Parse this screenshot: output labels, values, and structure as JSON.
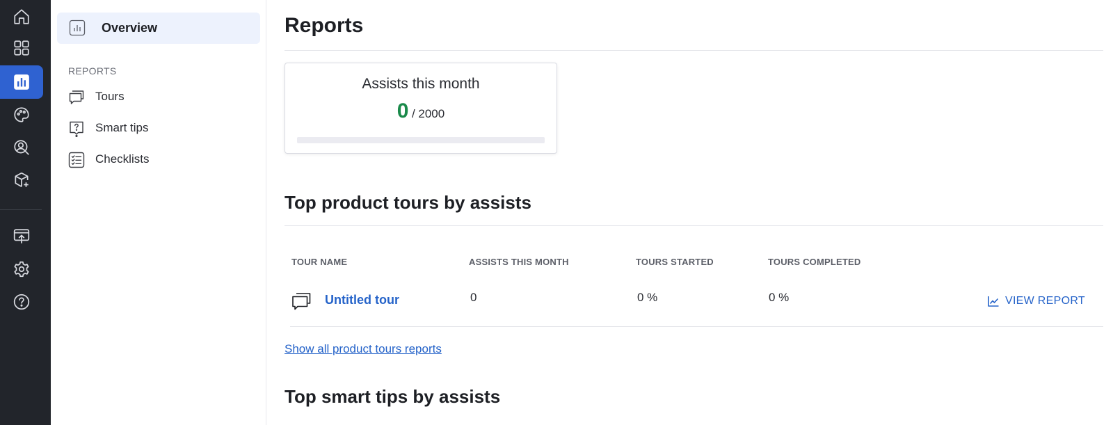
{
  "rail": {
    "items": [
      {
        "icon": "home-icon",
        "active": false
      },
      {
        "icon": "apps-grid-icon",
        "active": false
      },
      {
        "icon": "reports-chart-icon",
        "active": true
      },
      {
        "icon": "palette-icon",
        "active": false
      },
      {
        "icon": "user-search-icon",
        "active": false
      },
      {
        "icon": "package-add-icon",
        "active": false
      },
      {
        "icon": "publish-upload-icon",
        "active": false
      },
      {
        "icon": "gear-icon",
        "active": false
      },
      {
        "icon": "help-icon",
        "active": false
      }
    ],
    "active_color": "#2f62d1",
    "background": "#22252b"
  },
  "subnav": {
    "overview_label": "Overview",
    "section_label": "REPORTS",
    "items": [
      {
        "label": "Tours",
        "icon": "tours-chat-icon"
      },
      {
        "label": "Smart tips",
        "icon": "smart-tips-icon"
      },
      {
        "label": "Checklists",
        "icon": "checklist-icon"
      }
    ]
  },
  "main": {
    "title": "Reports",
    "assists_card": {
      "title": "Assists this month",
      "count": "0",
      "total": "/ 2000",
      "progress": 0
    },
    "tours_section": {
      "title": "Top product tours by assists",
      "columns": [
        "TOUR NAME",
        "ASSISTS THIS MONTH",
        "TOURS STARTED",
        "TOURS COMPLETED"
      ],
      "rows": [
        {
          "name": "Untitled tour",
          "assists": "0",
          "started": "0 %",
          "completed": "0 %",
          "action": "VIEW REPORT"
        }
      ],
      "show_all_link": "Show all product tours reports"
    },
    "smart_tips_section": {
      "title": "Top smart tips by assists"
    }
  },
  "colors": {
    "accent": "#2563c9",
    "success": "#1a8a4a"
  }
}
